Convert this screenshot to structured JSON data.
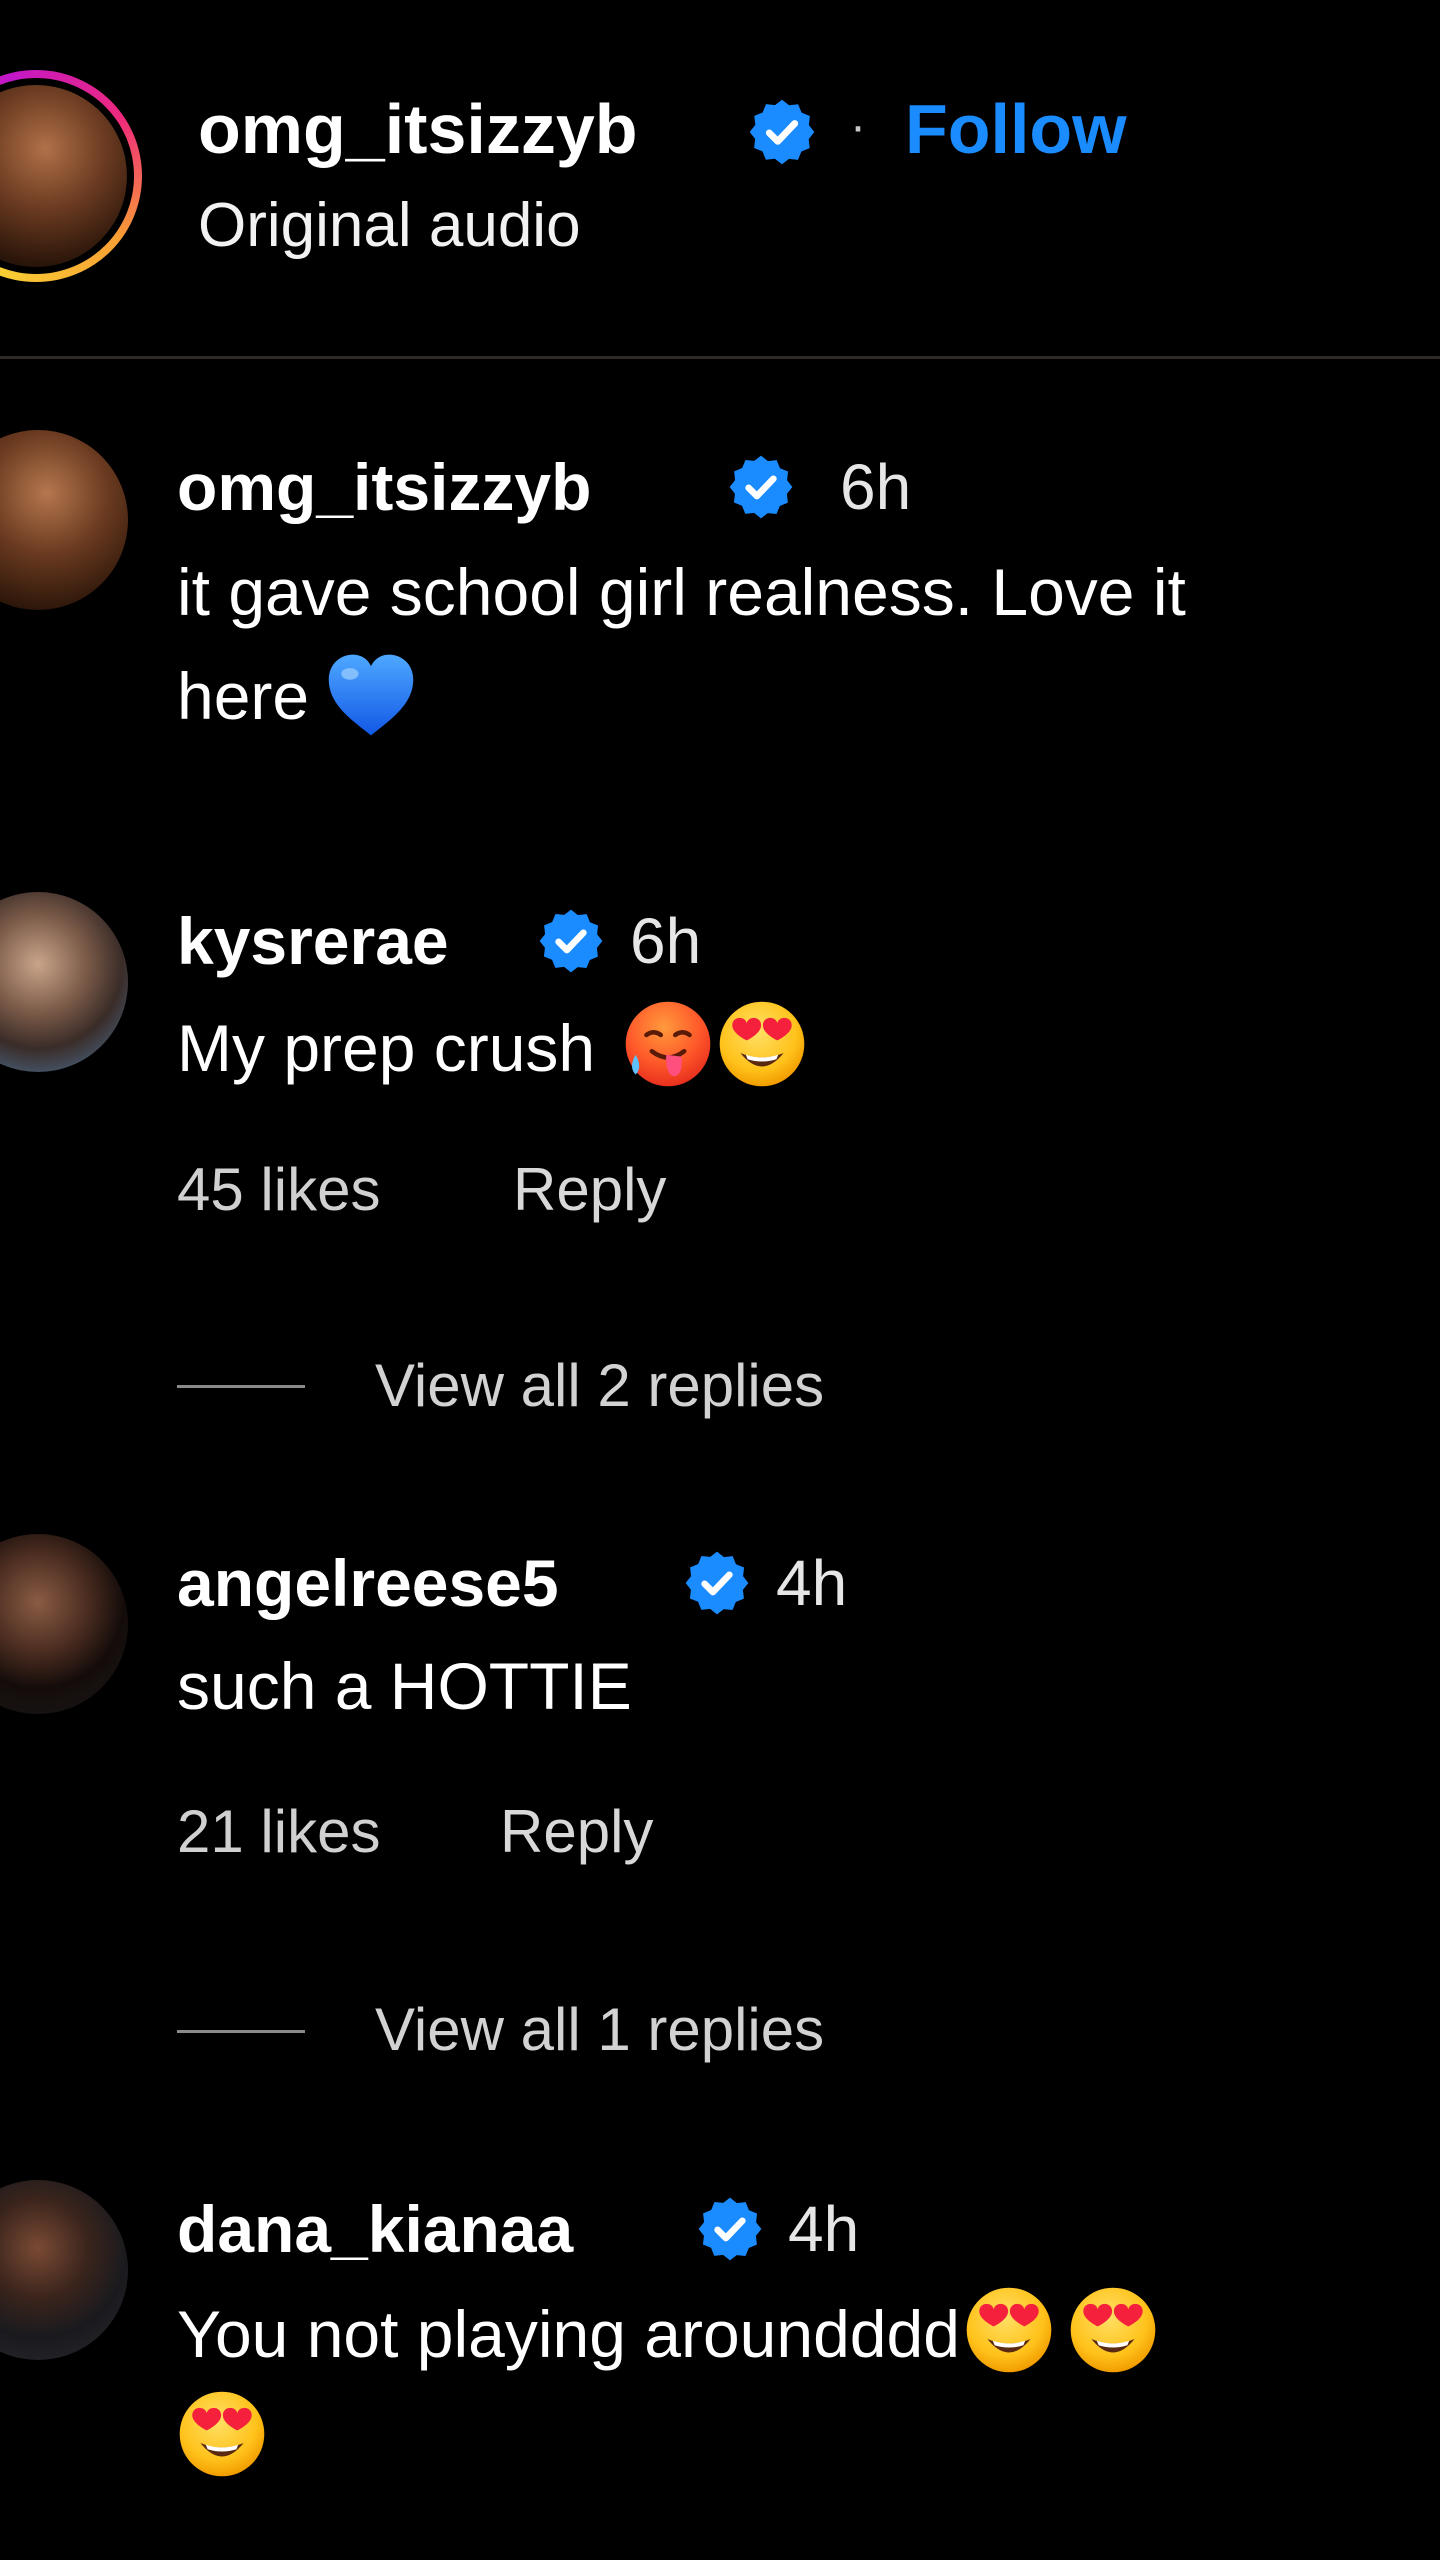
{
  "header": {
    "username": "omg_itsizzyb",
    "separator": "·",
    "follow_label": "Follow",
    "audio_label": "Original audio"
  },
  "comments": [
    {
      "username": "omg_itsizzyb",
      "time": "6h",
      "text_line1": "it gave school girl realness. Love it",
      "text_line2": "here",
      "emojis": [
        "blue-heart-icon"
      ]
    },
    {
      "username": "kysrerae",
      "time": "6h",
      "text": "My prep crush",
      "emojis": [
        "drooling-face-icon",
        "heart-eyes-icon"
      ],
      "likes": "45 likes",
      "reply_label": "Reply",
      "view_replies": "View all 2 replies"
    },
    {
      "username": "angelreese5",
      "time": "4h",
      "text": "such a HOTTIE",
      "likes": "21 likes",
      "reply_label": "Reply",
      "view_replies": "View all 1 replies"
    },
    {
      "username": "dana_kianaa",
      "time": "4h",
      "text": "You not playing aroundddd",
      "emojis": [
        "heart-eyes-icon",
        "heart-eyes-icon",
        "heart-eyes-icon"
      ]
    }
  ],
  "colors": {
    "background": "#000000",
    "follow_blue": "#1a8cff",
    "verified_blue": "#1a8cff"
  }
}
